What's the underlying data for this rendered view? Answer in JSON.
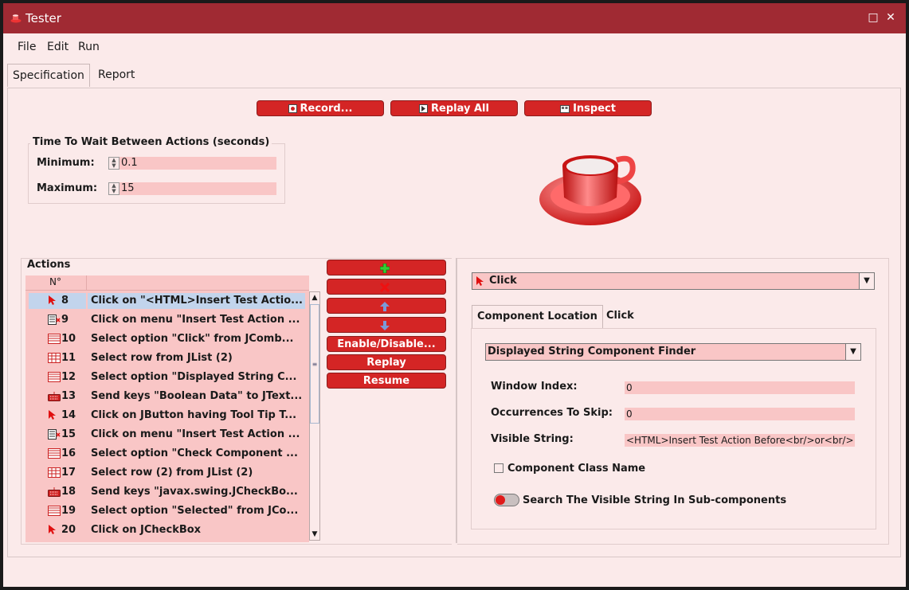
{
  "window": {
    "title": "Tester"
  },
  "menu": [
    "File",
    "Edit",
    "Run"
  ],
  "tabs": [
    "Specification",
    "Report"
  ],
  "toolbar": {
    "record_label": "Record...",
    "replay_all_label": "Replay All",
    "inspect_label": "Inspect"
  },
  "timing": {
    "group_label": "Time To Wait Between Actions (seconds)",
    "minimum_label": "Minimum:",
    "minimum_value": "0.1",
    "maximum_label": "Maximum:",
    "maximum_value": "15"
  },
  "actions": {
    "group_label": "Actions",
    "col_num": "N°",
    "rows": [
      {
        "n": "8",
        "icon": "pointer-icon",
        "text": "Click on \"<HTML>Insert Test Actio...",
        "selected": true
      },
      {
        "n": "9",
        "icon": "menu-icon",
        "text": "Click on menu \"Insert Test Action ..."
      },
      {
        "n": "10",
        "icon": "combo-icon",
        "text": "Select option  \"Click\" from JComb..."
      },
      {
        "n": "11",
        "icon": "list-icon",
        "text": "Select row from JList (2)"
      },
      {
        "n": "12",
        "icon": "combo-icon",
        "text": "Select option  \"Displayed String C..."
      },
      {
        "n": "13",
        "icon": "keyboard-icon",
        "text": "Send keys \"Boolean Data\" to JText..."
      },
      {
        "n": "14",
        "icon": "pointer-icon",
        "text": "Click on JButton having  Tool Tip T..."
      },
      {
        "n": "15",
        "icon": "menu-icon",
        "text": "Click on menu \"Insert Test Action ..."
      },
      {
        "n": "16",
        "icon": "combo-icon",
        "text": "Select option  \"Check Component ..."
      },
      {
        "n": "17",
        "icon": "list-icon",
        "text": "Select row (2) from JList (2)"
      },
      {
        "n": "18",
        "icon": "keyboard-icon",
        "text": "Send keys \"javax.swing.JCheckBo..."
      },
      {
        "n": "19",
        "icon": "combo-icon",
        "text": "Select option  \"Selected\" from JCo..."
      },
      {
        "n": "20",
        "icon": "pointer-icon",
        "text": "Click on JCheckBox"
      }
    ]
  },
  "action_buttons": {
    "add_icon": "plus-icon",
    "remove_icon": "x-icon",
    "up_icon": "arrow-up-icon",
    "down_icon": "arrow-down-icon",
    "enable_disable_label": "Enable/Disable...",
    "replay_label": "Replay",
    "resume_label": "Resume"
  },
  "detail": {
    "action_type": "Click",
    "subtabs": [
      "Component Location",
      "Click"
    ],
    "finder": "Displayed String Component Finder",
    "window_index_label": "Window Index:",
    "window_index_value": "0",
    "occurrences_label": "Occurrences To Skip:",
    "occurrences_value": "0",
    "visible_string_label": "Visible String:",
    "visible_string_value": "<HTML>Insert Test Action Before<br/>or<br/>",
    "component_class_label": "Component Class Name",
    "component_class_checked": false,
    "search_sub_label": "Search The Visible String In Sub-components",
    "search_sub_on": false
  },
  "colors": {
    "title_bar": "#a02a33",
    "button": "#d42525",
    "field": "#f9c6c6",
    "background": "#fbeaea"
  }
}
